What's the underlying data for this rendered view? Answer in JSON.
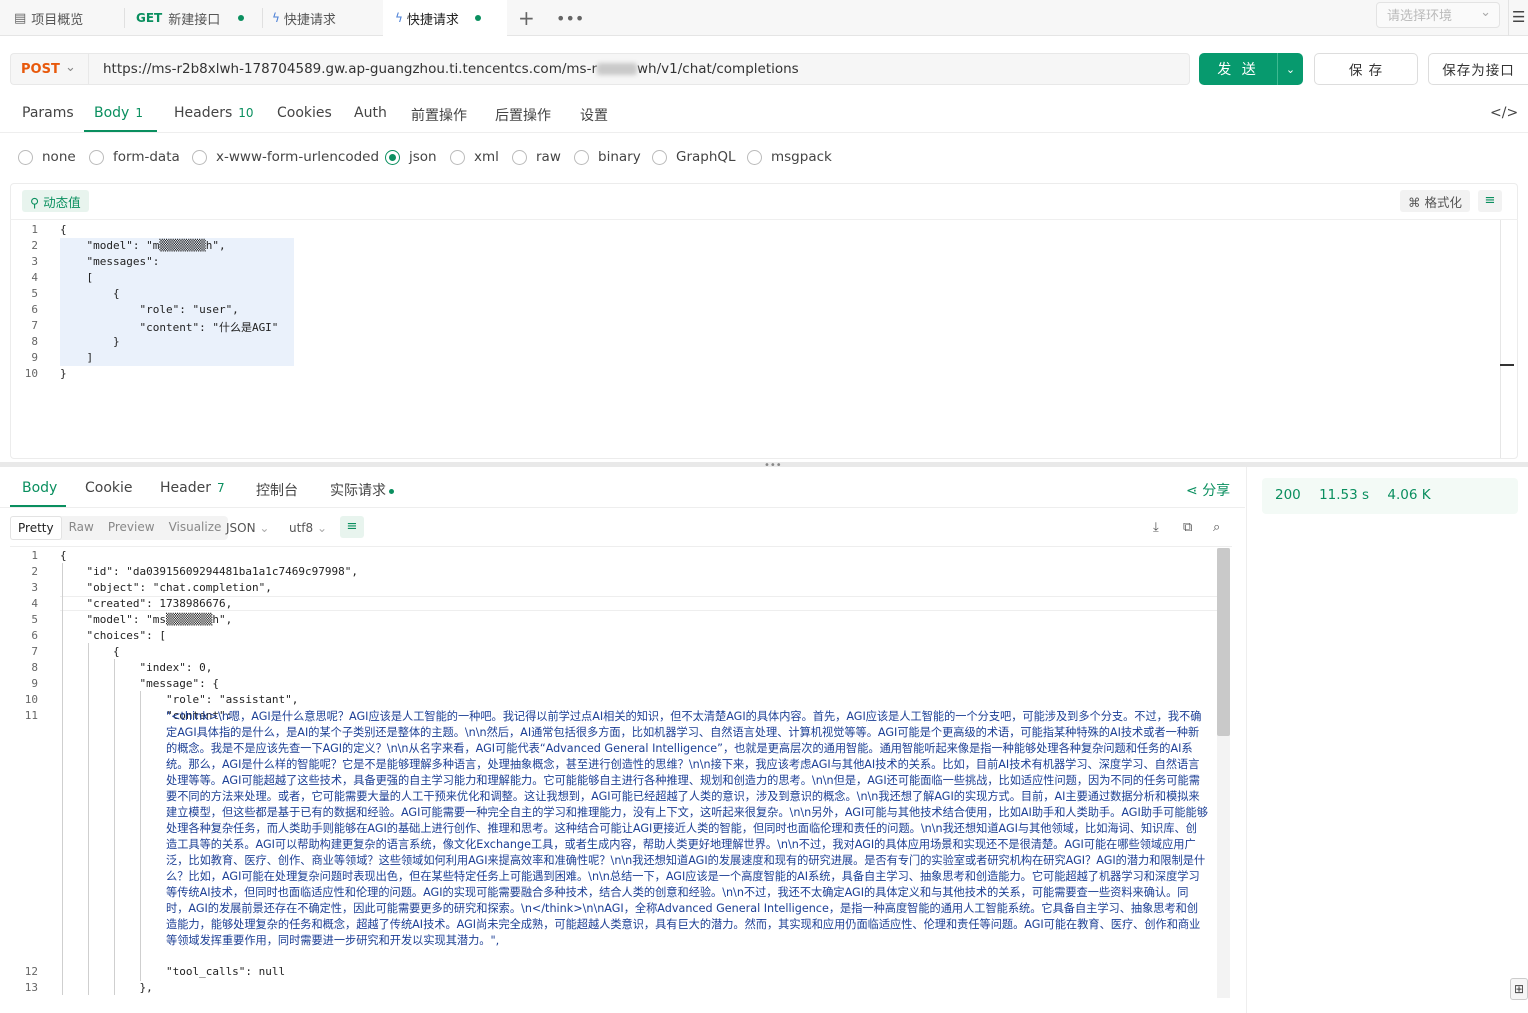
{
  "tabs": [
    {
      "label": "项目概览",
      "icon": "overview-icon"
    },
    {
      "method": "GET",
      "label": "新建接口",
      "dirty": true
    },
    {
      "label": "快捷请求",
      "icon": "lightning-icon"
    },
    {
      "label": "快捷请求",
      "icon": "lightning-icon",
      "dirty": true,
      "active": true
    }
  ],
  "env_placeholder": "请选择环境",
  "request": {
    "method": "POST",
    "url_prefix": "https://ms-r2b8xlwh-178704589.gw.ap-guangzhou.ti.tencentcs.com/ms-r",
    "url_suffix": "wh/v1/chat/completions",
    "send_label": "发 送",
    "save_label": "保 存",
    "save_as_label": "保存为接口"
  },
  "req_tabs": [
    {
      "label": "Params",
      "count": ""
    },
    {
      "label": "Body",
      "count": "1"
    },
    {
      "label": "Headers",
      "count": "10"
    },
    {
      "label": "Cookies",
      "count": ""
    },
    {
      "label": "Auth",
      "count": ""
    },
    {
      "label": "前置操作",
      "count": ""
    },
    {
      "label": "后置操作",
      "count": ""
    },
    {
      "label": "设置",
      "count": ""
    }
  ],
  "body_types": [
    "none",
    "form-data",
    "x-www-form-urlencoded",
    "json",
    "xml",
    "raw",
    "binary",
    "GraphQL",
    "msgpack"
  ],
  "body_type_selected": "json",
  "dynamic_label": "动态值",
  "format_label": "格式化",
  "req_body_lines": [
    {
      "n": "1",
      "t": "{"
    },
    {
      "n": "2",
      "t": "    \"model\": \"m▒▒▒▒▒▒▒h\","
    },
    {
      "n": "3",
      "t": "    \"messages\":"
    },
    {
      "n": "4",
      "t": "    ["
    },
    {
      "n": "5",
      "t": "        {"
    },
    {
      "n": "6",
      "t": "            \"role\": \"user\","
    },
    {
      "n": "7",
      "t": "            \"content\": \"什么是AGI\""
    },
    {
      "n": "8",
      "t": "        }"
    },
    {
      "n": "9",
      "t": "    ]"
    },
    {
      "n": "10",
      "t": "}"
    }
  ],
  "resp_tabs": [
    {
      "label": "Body",
      "count": ""
    },
    {
      "label": "Cookie",
      "count": ""
    },
    {
      "label": "Header",
      "count": "7"
    },
    {
      "label": "控制台",
      "count": ""
    },
    {
      "label": "实际请求",
      "count": ""
    }
  ],
  "share_label": "分享",
  "status": {
    "code": "200",
    "time": "11.53 s",
    "size": "4.06 K"
  },
  "view_modes": [
    "Pretty",
    "Raw",
    "Preview",
    "Visualize"
  ],
  "view_selected": "Pretty",
  "format_select": "JSON",
  "encoding_select": "utf8",
  "resp_lines": [
    {
      "n": "1",
      "t": "{"
    },
    {
      "n": "2",
      "t": "    \"id\": \"da03915609294481ba1a1c7469c97998\","
    },
    {
      "n": "3",
      "t": "    \"object\": \"chat.completion\","
    },
    {
      "n": "4",
      "t": "    \"created\": 1738986676,"
    },
    {
      "n": "5",
      "t": "    \"model\": \"ms▒▒▒▒▒▒▒h\","
    },
    {
      "n": "6",
      "t": "    \"choices\": ["
    },
    {
      "n": "7",
      "t": "        {"
    },
    {
      "n": "8",
      "t": "            \"index\": 0,"
    },
    {
      "n": "9",
      "t": "            \"message\": {"
    },
    {
      "n": "10",
      "t": "                \"role\": \"assistant\","
    },
    {
      "n": "11",
      "t": "                \"content\": "
    },
    {
      "n": "12",
      "t": "                \"tool_calls\": null"
    },
    {
      "n": "13",
      "t": "            },"
    }
  ],
  "resp_content": "\"<think>\\n嗯，AGI是什么意思呢？AGI应该是人工智能的一种吧。我记得以前学过点AI相关的知识，但不太清楚AGI的具体内容。首先，AGI应该是人工智能的一个分支吧，可能涉及到多个分支。不过，我不确定AGI具体指的是什么，是AI的某个子类别还是整体的主题。\\n\\n然后，AI通常包括很多方面，比如机器学习、自然语言处理、计算机视觉等等。AGI可能是个更高级的术语，可能指某种特殊的AI技术或者一种新的概念。我是不是应该先查一下AGI的定义？\\n\\n从名字来看，AGI可能代表“Advanced General Intelligence”，也就是更高层次的通用智能。通用智能听起来像是指一种能够处理各种复杂问题和任务的AI系统。那么，AGI是什么样的智能呢？它是不是能够理解多种语言，处理抽象概念，甚至进行创造性的思维？\\n\\n接下来，我应该考虑AGI与其他AI技术的关系。比如，目前AI技术有机器学习、深度学习、自然语言处理等等。AGI可能超越了这些技术，具备更强的自主学习能力和理解能力。它可能能够自主进行各种推理、规划和创造力的思考。\\n\\n但是，AGI还可能面临一些挑战，比如适应性问题，因为不同的任务可能需要不同的方法来处理。或者，它可能需要大量的人工干预来优化和调整。这让我想到，AGI可能已经超越了人类的意识，涉及到意识的概念。\\n\\n我还想了解AGI的实现方式。目前，AI主要通过数据分析和模拟来建立模型，但这些都是基于已有的数据和经验。AGI可能需要一种完全自主的学习和推理能力，没有上下文，这听起来很复杂。\\n\\n另外，AGI可能与其他技术结合使用，比如AI助手和人类助手。AGI助手可能能够处理各种复杂任务，而人类助手则能够在AGI的基础上进行创作、推理和思考。这种结合可能让AGI更接近人类的智能，但同时也面临伦理和责任的问题。\\n\\n我还想知道AGI与其他领域，比如海词、知识库、创造工具等的关系。AGI可以帮助构建更复杂的语言系统，像文化Exchange工具，或者生成内容，帮助人类更好地理解世界。\\n\\n不过，我对AGI的具体应用场景和实现还不是很清楚。AGI可能在哪些领域应用广泛，比如教育、医疗、创作、商业等领域？这些领域如何利用AGI来提高效率和准确性呢？\\n\\n我还想知道AGI的发展速度和现有的研究进展。是否有专门的实验室或者研究机构在研究AGI？AGI的潜力和限制是什么？比如，AGI可能在处理复杂问题时表现出色，但在某些特定任务上可能遇到困难。\\n\\n总结一下，AGI应该是一个高度智能的AI系统，具备自主学习、抽象思考和创造能力。它可能超越了机器学习和深度学习等传统AI技术，但同时也面临适应性和伦理的问题。AGI的实现可能需要融合多种技术，结合人类的创意和经验。\\n\\n不过，我还不太确定AGI的具体定义和与其他技术的关系，可能需要查一些资料来确认。同时，AGI的发展前景还存在不确定性，因此可能需要更多的研究和探索。\\n</think>\\n\\nAGI，全称Advanced General Intelligence，是指一种高度智能的通用人工智能系统。它具备自主学习、抽象思考和创造能力，能够处理复杂的任务和概念，超越了传统AI技术。AGI尚未完全成熟，可能超越人类意识，具有巨大的潜力。然而，其实现和应用仍面临适应性、伦理和责任等问题。AGI可能在教育、医疗、创作和商业等领域发挥重要作用，同时需要进一步研究和开发以实现其潜力。\","
}
